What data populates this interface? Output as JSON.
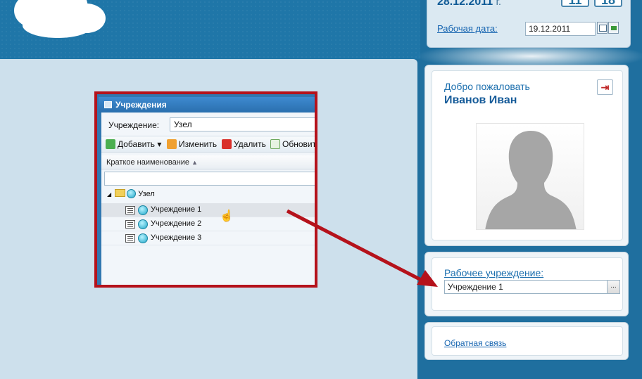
{
  "header": {
    "date_big": "28.12.2011",
    "date_suffix": "г.",
    "clock_hours": "11",
    "clock_minutes": "18",
    "workdate_label": "Рабочая дата:",
    "workdate_value": "19.12.2011"
  },
  "profile": {
    "welcome": "Добро пожаловать",
    "user_name": "Иванов Иван",
    "logout_icon": "logout-icon"
  },
  "organization": {
    "label": "Рабочее учреждение:",
    "value": "Учреждение 1",
    "picker_label": "..."
  },
  "feedback": {
    "link": "Обратная связь"
  },
  "embedded_window": {
    "title": "Учреждения",
    "field_label": "Учреждение:",
    "field_value": "Узел",
    "toolbar": {
      "add": "Добавить",
      "edit": "Изменить",
      "delete": "Удалить",
      "refresh": "Обновить"
    },
    "column_header": "Краткое наименование",
    "tree": {
      "root": "Узел",
      "items": [
        "Учреждение 1",
        "Учреждение 2",
        "Учреждение 3"
      ]
    }
  },
  "colors": {
    "annotation_red": "#b5121b",
    "header_blue": "#1f76a8",
    "link_blue": "#1564b0"
  }
}
